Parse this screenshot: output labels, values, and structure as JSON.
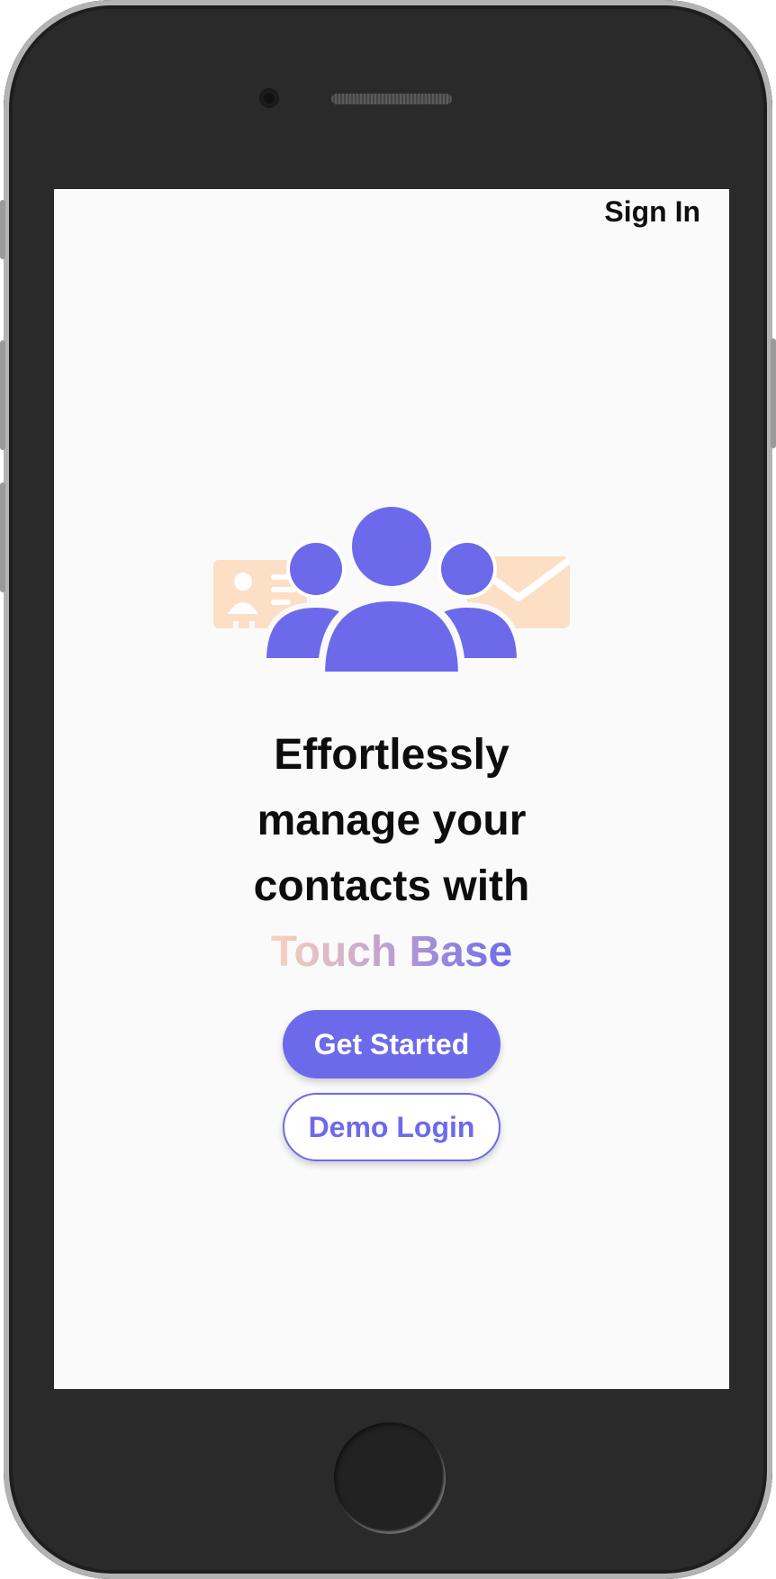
{
  "header": {
    "sign_in_label": "Sign In"
  },
  "hero": {
    "illustration_icon": "contacts-group-icon",
    "card_icon": "contact-card-icon",
    "mail_icon": "envelope-icon"
  },
  "headline": {
    "line1": "Effortlessly",
    "line2": "manage your",
    "line3": "contacts with",
    "brand": "Touch Base"
  },
  "actions": {
    "get_started_label": "Get Started",
    "demo_login_label": "Demo Login"
  },
  "colors": {
    "accent": "#6c6aeb",
    "accent_light": "#fddfc5",
    "screen_bg": "#fafafa",
    "text": "#0d0d0d"
  }
}
